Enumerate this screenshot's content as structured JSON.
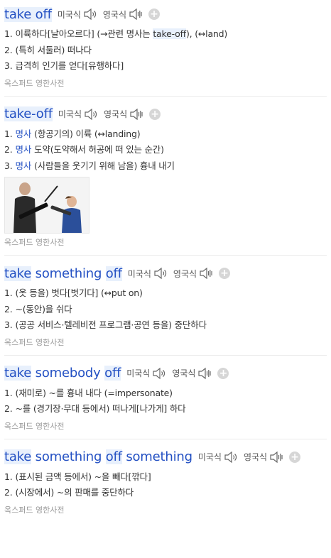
{
  "entries": [
    {
      "headword_parts": [
        {
          "text": "take off",
          "hl": true
        }
      ],
      "us_label": "미국식",
      "uk_label": "영국식",
      "definitions": [
        {
          "num": "1.",
          "pos": "",
          "text": "이륙하다[날아오르다] (→관련 명사는 ",
          "kw": "take-off",
          "tail": "), (↔land)"
        },
        {
          "num": "2.",
          "pos": "",
          "text": "(특히 서둘러) 떠나다",
          "kw": "",
          "tail": ""
        },
        {
          "num": "3.",
          "pos": "",
          "text": "급격히 인기를 얻다[유행하다]",
          "kw": "",
          "tail": ""
        }
      ],
      "source": "옥스퍼드 영한사전"
    },
    {
      "headword_parts": [
        {
          "text": "take-off",
          "hl": true
        }
      ],
      "us_label": "미국식",
      "uk_label": "영국식",
      "definitions": [
        {
          "num": "1.",
          "pos": "명사",
          "text": "(항공기의) 이륙 (↔landing)",
          "kw": "",
          "tail": ""
        },
        {
          "num": "2.",
          "pos": "명사",
          "text": "도약(도약해서 허공에 떠 있는 순간)",
          "kw": "",
          "tail": ""
        },
        {
          "num": "3.",
          "pos": "명사",
          "text": "(사람들을 웃기기 위해 남을) 흉내 내기",
          "kw": "",
          "tail": ""
        }
      ],
      "has_image": true,
      "source": "옥스퍼드 영한사전"
    },
    {
      "headword_parts": [
        {
          "text": "take",
          "hl": true
        },
        {
          "text": " something ",
          "hl": false
        },
        {
          "text": "off",
          "hl": true
        }
      ],
      "us_label": "미국식",
      "uk_label": "영국식",
      "definitions": [
        {
          "num": "1.",
          "pos": "",
          "text": "(옷 등을) 벗다[벗기다] (↔put on)",
          "kw": "",
          "tail": ""
        },
        {
          "num": "2.",
          "pos": "",
          "text": "~(동안)을 쉬다",
          "kw": "",
          "tail": ""
        },
        {
          "num": "3.",
          "pos": "",
          "text": "(공공 서비스·텔레비전 프로그램·공연 등을) 중단하다",
          "kw": "",
          "tail": ""
        }
      ],
      "source": "옥스퍼드 영한사전"
    },
    {
      "headword_parts": [
        {
          "text": "take",
          "hl": true
        },
        {
          "text": " somebody ",
          "hl": false
        },
        {
          "text": "off",
          "hl": true
        }
      ],
      "us_label": "미국식",
      "uk_label": "영국식",
      "definitions": [
        {
          "num": "1.",
          "pos": "",
          "text": "(재미로) ~를 흉내 내다 (=impersonate)",
          "kw": "",
          "tail": ""
        },
        {
          "num": "2.",
          "pos": "",
          "text": "~를 (경기장·무대 등에서) 떠나게[나가게] 하다",
          "kw": "",
          "tail": ""
        }
      ],
      "source": "옥스퍼드 영한사전"
    },
    {
      "headword_parts": [
        {
          "text": "take",
          "hl": true
        },
        {
          "text": " something ",
          "hl": false
        },
        {
          "text": "off",
          "hl": true
        },
        {
          "text": " something",
          "hl": false
        }
      ],
      "us_label": "미국식",
      "uk_label": "영국식",
      "definitions": [
        {
          "num": "1.",
          "pos": "",
          "text": "(표시된 금액 등에서) ~을 빼다[깎다]",
          "kw": "",
          "tail": ""
        },
        {
          "num": "2.",
          "pos": "",
          "text": "(시장에서) ~의 판매를 중단하다",
          "kw": "",
          "tail": ""
        }
      ],
      "source": "옥스퍼드 영한사전"
    }
  ]
}
